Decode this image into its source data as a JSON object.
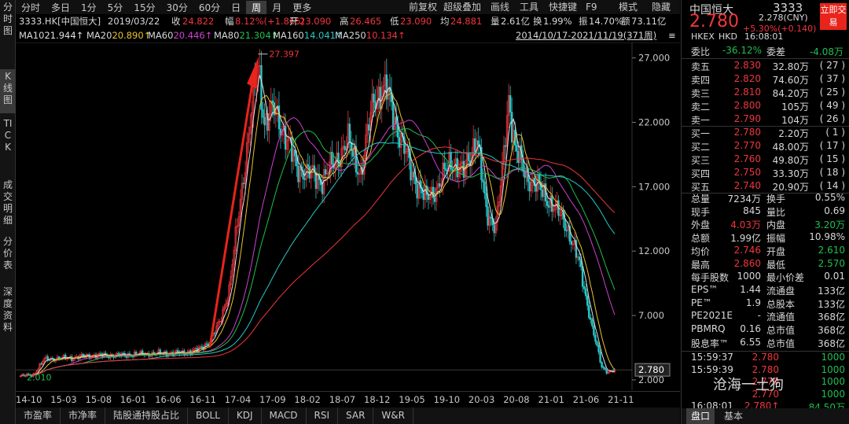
{
  "left_tabs": [
    "分时图",
    "K线图",
    "TICK",
    "成交明细",
    "分价表",
    "深度资料"
  ],
  "topbar": {
    "periods": [
      "分时",
      "多日",
      "1分",
      "5分",
      "15分",
      "30分",
      "60分",
      "日",
      "周",
      "月",
      "更多"
    ],
    "active": "周",
    "right": [
      "前复权",
      "超级叠加",
      "画线",
      "工具",
      "快捷键",
      "F9",
      "模式",
      "隐藏"
    ]
  },
  "info": {
    "code": "3333.HK[中国恒大]",
    "date": "2019/03/22",
    "close_label": "收",
    "close": "24.822",
    "chg_label": "幅",
    "chg": "8.12%(+1.865)",
    "open_label": "开",
    "open": "23.090",
    "high_label": "高",
    "high": "26.465",
    "low_label": "低",
    "low": "23.090",
    "avg_label": "均",
    "avg": "24.881",
    "vol_label": "量",
    "vol": "2.61亿",
    "turn_label": "换",
    "turn": "1.99%",
    "amp_label": "振",
    "amp": "14.70%",
    "amt_label": "额",
    "amt": "73.11亿"
  },
  "ma": [
    {
      "name": "MA10",
      "val": "21.944↑",
      "color": "#e0e0e0"
    },
    {
      "name": "MA20",
      "val": "20.890↑",
      "color": "#e8c32a"
    },
    {
      "name": "MA60",
      "val": "20.446↑",
      "color": "#d040d0"
    },
    {
      "name": "MA80",
      "val": "21.304↑",
      "color": "#1fbf4f"
    },
    {
      "name": "MA160",
      "val": "14.041↑",
      "color": "#27c8c8"
    },
    {
      "name": "MA250",
      "val": "10.134↑",
      "color": "#f0353d"
    }
  ],
  "range": "2014/10/17-2021/11/19(371周)",
  "chart_data": {
    "type": "candlestick",
    "ylim": [
      1.2,
      28.2
    ],
    "y_ticks": [
      {
        "v": 27,
        "label": "27.000"
      },
      {
        "v": 22,
        "label": "22.000"
      },
      {
        "v": 17,
        "label": "17.000"
      },
      {
        "v": 12,
        "label": "12.000"
      },
      {
        "v": 7,
        "label": "7.000"
      },
      {
        "v": 2,
        "label": "2.000"
      }
    ],
    "x_ticks": [
      "14-10",
      "15-03",
      "15-08",
      "16-01",
      "16-06",
      "16-11",
      "17-04",
      "17-09",
      "18-02",
      "18-07",
      "18-12",
      "19-05",
      "19-10",
      "20-03",
      "20-08",
      "21-01",
      "21-06",
      "21-11"
    ],
    "max_label": "27.397",
    "min_label": "2.010",
    "last_price": "2.780",
    "last_value": 2.78,
    "anchors": [
      [
        0,
        2.3
      ],
      [
        8,
        2.4
      ],
      [
        15,
        3.6
      ],
      [
        30,
        3.7
      ],
      [
        45,
        3.9
      ],
      [
        60,
        3.9
      ],
      [
        75,
        4.0
      ],
      [
        100,
        4.1
      ],
      [
        110,
        4.3
      ],
      [
        118,
        5.0
      ],
      [
        124,
        6.5
      ],
      [
        130,
        9
      ],
      [
        136,
        15
      ],
      [
        142,
        21
      ],
      [
        148,
        26.5
      ],
      [
        152,
        22
      ],
      [
        158,
        23
      ],
      [
        165,
        21
      ],
      [
        172,
        18.5
      ],
      [
        180,
        18
      ],
      [
        188,
        17.5
      ],
      [
        196,
        19
      ],
      [
        204,
        20.5
      ],
      [
        212,
        18
      ],
      [
        220,
        24
      ],
      [
        228,
        24.5
      ],
      [
        236,
        21
      ],
      [
        244,
        18
      ],
      [
        252,
        16
      ],
      [
        260,
        17
      ],
      [
        268,
        19
      ],
      [
        276,
        18
      ],
      [
        284,
        21
      ],
      [
        290,
        15
      ],
      [
        296,
        14
      ],
      [
        300,
        18
      ],
      [
        304,
        24
      ],
      [
        308,
        20
      ],
      [
        314,
        18
      ],
      [
        322,
        17
      ],
      [
        332,
        15.5
      ],
      [
        340,
        14
      ],
      [
        348,
        11
      ],
      [
        356,
        6
      ],
      [
        362,
        3
      ],
      [
        366,
        2.6
      ],
      [
        370,
        2.78
      ]
    ],
    "ma_series": [
      {
        "name": "MA10",
        "color": "#e0e0e0",
        "w": 5
      },
      {
        "name": "MA20",
        "color": "#e8c32a",
        "w": 10
      },
      {
        "name": "MA60",
        "color": "#d040d0",
        "w": 30
      },
      {
        "name": "MA80",
        "color": "#1fbf4f",
        "w": 40
      },
      {
        "name": "MA160",
        "color": "#27c8c8",
        "w": 80
      },
      {
        "name": "MA250",
        "color": "#f0353d",
        "w": 125
      }
    ]
  },
  "bottom_tabs": [
    "市盈率",
    "市净率",
    "陆股通持股占比",
    "BOLL",
    "KDJ",
    "MACD",
    "RSI",
    "SAR",
    "W&R"
  ],
  "right": {
    "name": "中国恒大",
    "code": "3333",
    "btn": "立即交易",
    "price": "2.780",
    "chg": "+5.30%(+0.140)",
    "cny": "2.278(CNY)",
    "exch": "HKEX",
    "ccy": "HKD",
    "time": "16:08:01",
    "weibi_label": "委比",
    "weibi": "-36.12%",
    "weicha_label": "委差",
    "weicha": "-4.08万",
    "asks": [
      {
        "l": "卖五",
        "p": "2.830",
        "v": "32.80万",
        "n": "( 27 )"
      },
      {
        "l": "卖四",
        "p": "2.820",
        "v": "74.60万",
        "n": "( 37 )"
      },
      {
        "l": "卖三",
        "p": "2.810",
        "v": "84.20万",
        "n": "( 25 )"
      },
      {
        "l": "卖二",
        "p": "2.800",
        "v": "105万",
        "n": "( 49 )"
      },
      {
        "l": "卖一",
        "p": "2.790",
        "v": "104万",
        "n": "( 26 )"
      }
    ],
    "bids": [
      {
        "l": "买一",
        "p": "2.780",
        "v": "2.20万",
        "n": "( 1 )"
      },
      {
        "l": "买二",
        "p": "2.770",
        "v": "48.00万",
        "n": "( 17 )"
      },
      {
        "l": "买三",
        "p": "2.760",
        "v": "49.80万",
        "n": "( 15 )"
      },
      {
        "l": "买四",
        "p": "2.750",
        "v": "33.30万",
        "n": "( 18 )"
      },
      {
        "l": "买五",
        "p": "2.740",
        "v": "20.90万",
        "n": "( 14 )"
      }
    ],
    "stats": [
      [
        "总量",
        "7234万",
        "换手",
        "0.55%",
        "wh",
        "wh"
      ],
      [
        "现手",
        "845",
        "量比",
        "0.69",
        "wh",
        "wh"
      ],
      [
        "外盘",
        "4.03万",
        "内盘",
        "3.20万",
        "up",
        "dn"
      ],
      [
        "总额",
        "1.99亿",
        "振幅",
        "10.98%",
        "wh",
        "wh"
      ],
      [
        "均价",
        "2.746",
        "开盘",
        "2.610",
        "up",
        "dn"
      ],
      [
        "最高",
        "2.860",
        "最低",
        "2.570",
        "up",
        "dn"
      ],
      [
        "每手股数",
        "1000",
        "最小价差",
        "0.01",
        "wh",
        "wh"
      ],
      [
        "EPS™",
        "1.44",
        "流通盘",
        "133亿",
        "wh",
        "wh"
      ],
      [
        "PE™",
        "1.9",
        "总股本",
        "133亿",
        "wh",
        "wh"
      ],
      [
        "PE2021E",
        "-",
        "流通值",
        "368亿",
        "wh",
        "wh"
      ],
      [
        "PBMRQ",
        "0.16",
        "总市值",
        "368亿",
        "wh",
        "wh"
      ],
      [
        "股息率™",
        "6.55",
        "总市值",
        "368亿",
        "wh",
        "wh"
      ]
    ],
    "ticks": [
      [
        "15:59:37",
        "2.780",
        "1000"
      ],
      [
        "15:59:39",
        "2.780",
        "1000"
      ],
      [
        "",
        "2.770",
        "1000"
      ],
      [
        "",
        "2.770",
        "1000"
      ],
      [
        "16:08:01",
        "2.780↑",
        "84.50万"
      ]
    ],
    "tabs": [
      "盘口",
      "基本"
    ],
    "watermark": "沧海一土狗"
  }
}
